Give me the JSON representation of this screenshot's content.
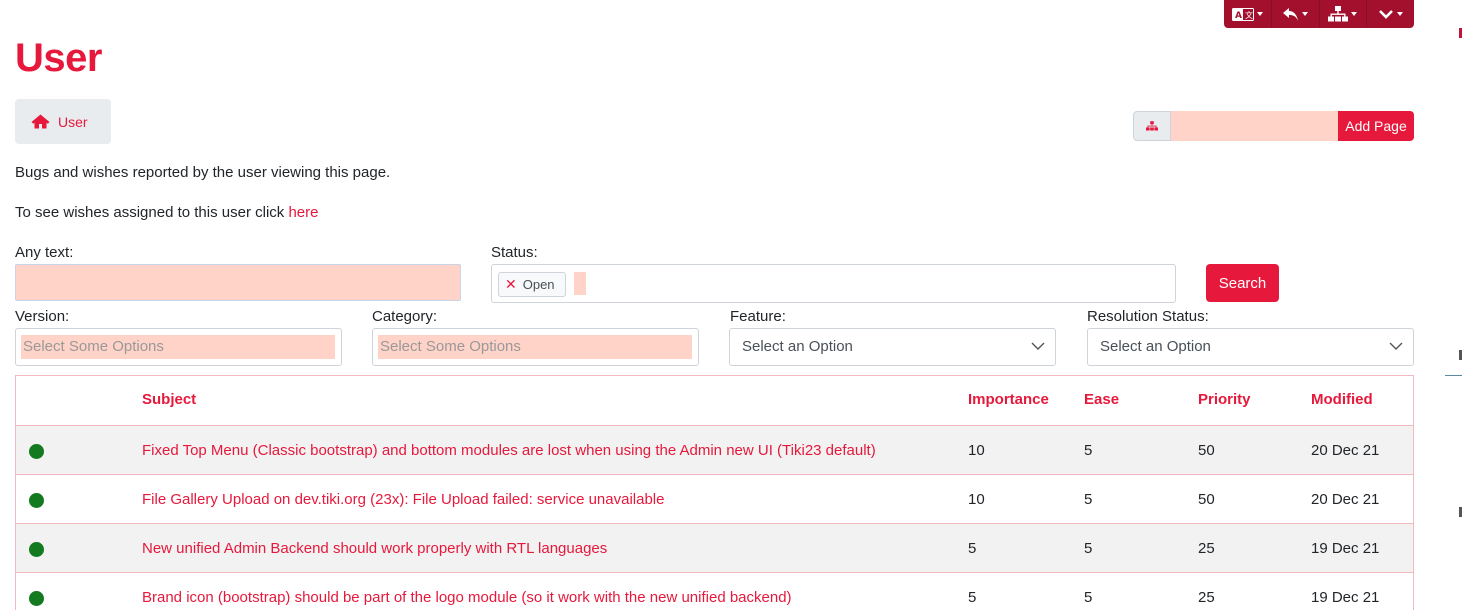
{
  "page": {
    "title": "User",
    "breadcrumb": "User",
    "add_page_button": "Add Page",
    "description": "Bugs and wishes reported by the user viewing this page.",
    "assigned_prefix": "To see wishes assigned to this user click",
    "assigned_link": "here"
  },
  "toolbar": {
    "icons": [
      "translate-icon",
      "undo-icon",
      "sitemap-icon",
      "chevron-down-icon"
    ]
  },
  "filters": {
    "any_text_label": "Any text:",
    "status_label": "Status:",
    "status_chip": "Open",
    "search_button": "Search",
    "version_label": "Version:",
    "version_placeholder": "Select Some Options",
    "category_label": "Category:",
    "category_placeholder": "Select Some Options",
    "feature_label": "Feature:",
    "feature_value": "Select an Option",
    "resolution_label": "Resolution Status:",
    "resolution_value": "Select an Option"
  },
  "table": {
    "headers": {
      "subject": "Subject",
      "importance": "Importance",
      "ease": "Ease",
      "priority": "Priority",
      "modified": "Modified"
    },
    "status_color": "#137a1f",
    "rows": [
      {
        "subject": "Fixed Top Menu (Classic bootstrap) and bottom modules are lost when using the Admin new UI (Tiki23 default)",
        "importance": "10",
        "ease": "5",
        "priority": "50",
        "modified": "20 Dec 21"
      },
      {
        "subject": "File Gallery Upload on dev.tiki.org (23x): File Upload failed: service unavailable",
        "importance": "10",
        "ease": "5",
        "priority": "50",
        "modified": "20 Dec 21"
      },
      {
        "subject": "New unified Admin Backend should work properly with RTL languages",
        "importance": "5",
        "ease": "5",
        "priority": "25",
        "modified": "19 Dec 21"
      },
      {
        "subject": "Brand icon (bootstrap) should be part of the logo module (so it work with the new unified backend)",
        "importance": "5",
        "ease": "5",
        "priority": "25",
        "modified": "19 Dec 21"
      }
    ]
  },
  "colors": {
    "accent": "#e6193c",
    "toolbar": "#a3102d",
    "input_highlight": "#ffd3c7"
  }
}
